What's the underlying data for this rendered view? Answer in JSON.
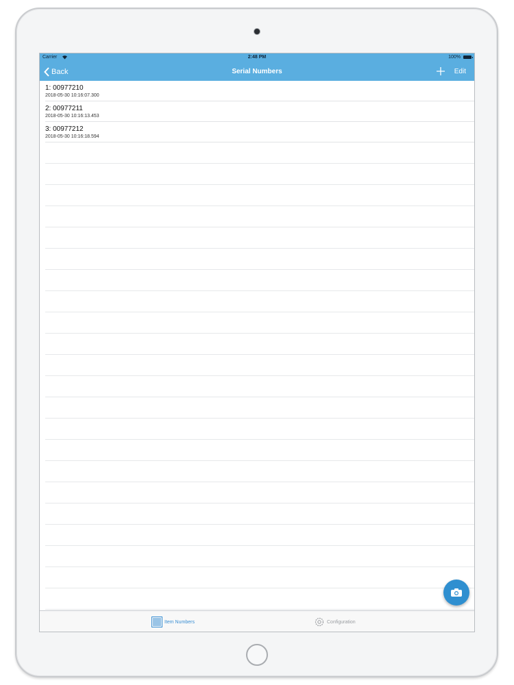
{
  "status_bar": {
    "carrier": "Carrier",
    "time": "2:48 PM",
    "battery": "100%"
  },
  "nav_bar": {
    "back_label": "Back",
    "title": "Serial Numbers",
    "edit_label": "Edit"
  },
  "serials": [
    {
      "label": "1:  00977210",
      "timestamp": "2018-05-30 10:16:07.300"
    },
    {
      "label": "2:  00977211",
      "timestamp": "2018-05-30 10:16:13.453"
    },
    {
      "label": "3:  00977212",
      "timestamp": "2018-05-30 10:16:18.594"
    }
  ],
  "tab_bar": {
    "item_numbers_label": "Item Numbers",
    "configuration_label": "Configuration"
  },
  "colors": {
    "accent": "#5aaee0",
    "fab": "#2f8fd0",
    "tab_active": "#3a8fd3"
  },
  "icons": [
    "wifi-icon",
    "back-chevron-icon",
    "plus-icon",
    "camera-icon",
    "barcode-icon",
    "gear-icon"
  ]
}
